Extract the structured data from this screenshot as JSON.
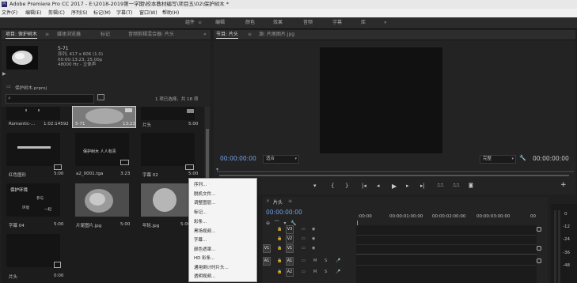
{
  "title": "Adobe Premiere Pro CC 2017 - E:\\2018-2019第一学期\\校本教材编写\\项目五\\02\\保护树木 *",
  "app_icon_label": "Pr",
  "menu": [
    "文件(F)",
    "编辑(E)",
    "剪辑(C)",
    "序列(S)",
    "标记(M)",
    "字幕(T)",
    "窗口(W)",
    "帮助(H)"
  ],
  "workspaces": [
    "组件",
    "编辑",
    "颜色",
    "效果",
    "音频",
    "字幕",
    "库"
  ],
  "workspace_more": "»",
  "project": {
    "tabs": [
      "项目: 保护树木",
      "媒体浏览器",
      "标记",
      "音频剪辑混合器: 片头"
    ],
    "clip_name": "5-71",
    "clip_info": [
      "序列, 417 x 606 (1.0)",
      "00:00:13:23, 25.00p",
      "48000 Hz - 立体声"
    ],
    "project_file": "保护树木.prproj",
    "search_placeholder": "",
    "selection_info": "1 项已选择，共 18 项",
    "items": [
      {
        "name": "Romantic-...",
        "dur": "1:02:14592"
      },
      {
        "name": "5-71",
        "dur": "13:23"
      },
      {
        "name": "片头",
        "dur": "5:00"
      },
      {
        "name": "红色图形",
        "dur": "5:00"
      },
      {
        "name": "a2_0001.tga",
        "dur": "3:23"
      },
      {
        "name": "字幕 02",
        "dur": "5:00"
      },
      {
        "name": "字幕 04",
        "dur": "5:00"
      },
      {
        "name": "片尾图片.jpg",
        "dur": "5:00"
      },
      {
        "name": "年轮.jpg",
        "dur": "5:00"
      },
      {
        "name": "片头",
        "dur": "0:00"
      }
    ],
    "title_card_1_text": "保护树木  人人有责",
    "title_card_2_lines": [
      "保护环境",
      "参与",
      "环境",
      "一起"
    ]
  },
  "program": {
    "tabs": [
      "节目: 片头",
      "源: 片尾图片.jpg"
    ],
    "timecode_left": "00:00:00:00",
    "fit": "适合",
    "quality": "完整",
    "timecode_right": "00:00:00:00"
  },
  "transport": [
    "▾",
    "{",
    "}",
    "|◂",
    "◂|",
    "◂",
    "▶",
    "▸",
    "▸|"
  ],
  "timeline": {
    "tab": "片头",
    "timecode": "00:00:00:00",
    "ruler": [
      ":00:00",
      "00:00:01:00:00",
      "00:00:02:00:00",
      "00:00:03:00:00",
      "00"
    ],
    "tracks": [
      {
        "src": "",
        "name": "V3"
      },
      {
        "src": "",
        "name": "V2"
      },
      {
        "src": "V1",
        "name": "V1"
      },
      {
        "src": "A1",
        "name": "A1"
      },
      {
        "src": "",
        "name": "A2"
      },
      {
        "src": "",
        "name": "A3"
      }
    ],
    "meter_ticks": [
      "0",
      "-12",
      "-24",
      "-36",
      "-48"
    ]
  },
  "context_menu": [
    "序列...",
    "脱机文件...",
    "调整图层...",
    "彩条...",
    "黑场视频...",
    "字幕...",
    "颜色遮罩...",
    "HD 彩条...",
    "通用倒计时片头...",
    "透明视频..."
  ],
  "context_menu_header": "标记...",
  "colors": {
    "bg": "#1f1f1f",
    "accent": "#6fa0e6",
    "menu_bg": "#f4f4f4"
  }
}
